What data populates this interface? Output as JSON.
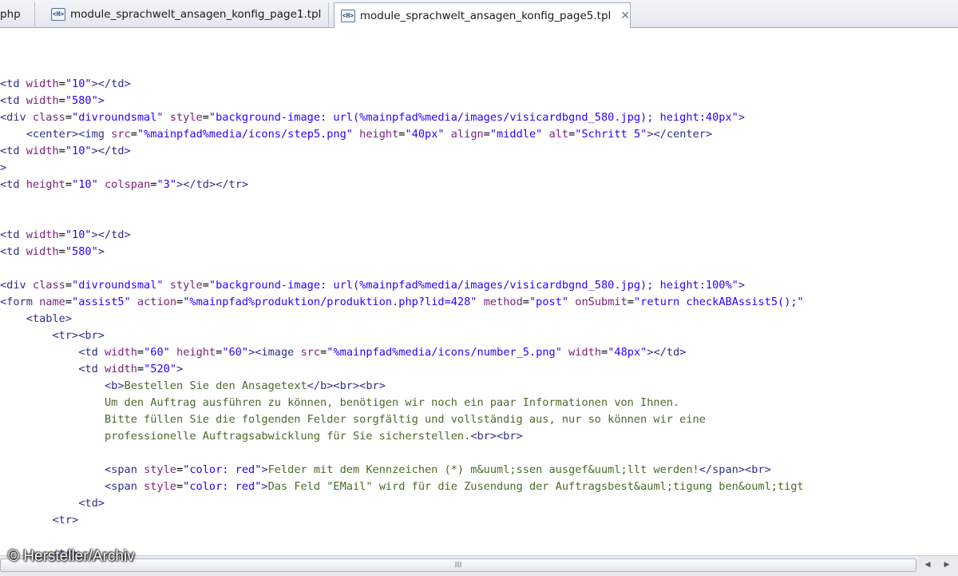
{
  "tabs": [
    {
      "label": "php",
      "active": false,
      "partial": true
    },
    {
      "label": "module_sprachwelt_ansagen_konfig_page1.tpl",
      "active": false,
      "icon": "html-file-icon"
    },
    {
      "label": "module_sprachwelt_ansagen_konfig_page5.tpl",
      "active": true,
      "icon": "html-file-icon",
      "close": "✕"
    }
  ],
  "code_lines": [
    [
      [
        "tag",
        "<td "
      ],
      [
        "attr",
        "width"
      ],
      [
        "plain",
        "="
      ],
      [
        "val",
        "\"10\""
      ],
      [
        "tag",
        "></td>"
      ]
    ],
    [
      [
        "tag",
        "<td "
      ],
      [
        "attr",
        "width"
      ],
      [
        "plain",
        "="
      ],
      [
        "val",
        "\"580\""
      ],
      [
        "tag",
        ">"
      ]
    ],
    [
      [
        "tag",
        "<div "
      ],
      [
        "attr",
        "class"
      ],
      [
        "plain",
        "="
      ],
      [
        "val",
        "\"divroundsmal\""
      ],
      [
        "plain",
        " "
      ],
      [
        "attr",
        "style"
      ],
      [
        "plain",
        "="
      ],
      [
        "val",
        "\"background-image: url(%mainpfad%media/images/visicardbgnd_580.jpg); height:40px\""
      ],
      [
        "tag",
        ">"
      ]
    ],
    [
      [
        "plain",
        "    "
      ],
      [
        "tag",
        "<center><img "
      ],
      [
        "attr",
        "src"
      ],
      [
        "plain",
        "="
      ],
      [
        "val",
        "\"%mainpfad%media/icons/step5.png\""
      ],
      [
        "plain",
        " "
      ],
      [
        "attr",
        "height"
      ],
      [
        "plain",
        "="
      ],
      [
        "val",
        "\"40px\""
      ],
      [
        "plain",
        " "
      ],
      [
        "attr",
        "align"
      ],
      [
        "plain",
        "="
      ],
      [
        "val",
        "\"middle\""
      ],
      [
        "plain",
        " "
      ],
      [
        "attr",
        "alt"
      ],
      [
        "plain",
        "="
      ],
      [
        "val",
        "\"Schritt 5\""
      ],
      [
        "tag",
        "></center>"
      ]
    ],
    [
      [
        "tag",
        "<td "
      ],
      [
        "attr",
        "width"
      ],
      [
        "plain",
        "="
      ],
      [
        "val",
        "\"10\""
      ],
      [
        "tag",
        "></td>"
      ]
    ],
    [
      [
        "tag",
        ">"
      ]
    ],
    [
      [
        "tag",
        "<td "
      ],
      [
        "attr",
        "height"
      ],
      [
        "plain",
        "="
      ],
      [
        "val",
        "\"10\""
      ],
      [
        "plain",
        " "
      ],
      [
        "attr",
        "colspan"
      ],
      [
        "plain",
        "="
      ],
      [
        "val",
        "\"3\""
      ],
      [
        "tag",
        "></td></tr>"
      ]
    ],
    [],
    [],
    [
      [
        "tag",
        "<td "
      ],
      [
        "attr",
        "width"
      ],
      [
        "plain",
        "="
      ],
      [
        "val",
        "\"10\""
      ],
      [
        "tag",
        "></td>"
      ]
    ],
    [
      [
        "tag",
        "<td "
      ],
      [
        "attr",
        "width"
      ],
      [
        "plain",
        "="
      ],
      [
        "val",
        "\"580\""
      ],
      [
        "tag",
        ">"
      ]
    ],
    [],
    [
      [
        "tag",
        "<div "
      ],
      [
        "attr",
        "class"
      ],
      [
        "plain",
        "="
      ],
      [
        "val",
        "\"divroundsmal\""
      ],
      [
        "plain",
        " "
      ],
      [
        "attr",
        "style"
      ],
      [
        "plain",
        "="
      ],
      [
        "val",
        "\"background-image: url(%mainpfad%media/images/visicardbgnd_580.jpg); height:100%\""
      ],
      [
        "tag",
        ">"
      ]
    ],
    [
      [
        "tag",
        "<form "
      ],
      [
        "attr",
        "name"
      ],
      [
        "plain",
        "="
      ],
      [
        "val",
        "\"assist5\""
      ],
      [
        "plain",
        " "
      ],
      [
        "attr",
        "action"
      ],
      [
        "plain",
        "="
      ],
      [
        "val",
        "\"%mainpfad%produktion/produktion.php?lid=428\""
      ],
      [
        "plain",
        " "
      ],
      [
        "attr",
        "method"
      ],
      [
        "plain",
        "="
      ],
      [
        "val",
        "\"post\""
      ],
      [
        "plain",
        " "
      ],
      [
        "attr",
        "onSubmit"
      ],
      [
        "plain",
        "="
      ],
      [
        "val",
        "\"return checkABAssist5();\""
      ]
    ],
    [
      [
        "plain",
        "    "
      ],
      [
        "tag",
        "<table>"
      ]
    ],
    [
      [
        "plain",
        "        "
      ],
      [
        "tag",
        "<tr><br>"
      ]
    ],
    [
      [
        "plain",
        "            "
      ],
      [
        "tag",
        "<td "
      ],
      [
        "attr",
        "width"
      ],
      [
        "plain",
        "="
      ],
      [
        "val",
        "\"60\""
      ],
      [
        "plain",
        " "
      ],
      [
        "attr",
        "height"
      ],
      [
        "plain",
        "="
      ],
      [
        "val",
        "\"60\""
      ],
      [
        "tag",
        "><image "
      ],
      [
        "attr",
        "src"
      ],
      [
        "plain",
        "="
      ],
      [
        "val",
        "\"%mainpfad%media/icons/number_5.png\""
      ],
      [
        "plain",
        " "
      ],
      [
        "attr",
        "width"
      ],
      [
        "plain",
        "="
      ],
      [
        "val",
        "\"48px\""
      ],
      [
        "tag",
        "></td>"
      ]
    ],
    [
      [
        "plain",
        "            "
      ],
      [
        "tag",
        "<td "
      ],
      [
        "attr",
        "width"
      ],
      [
        "plain",
        "="
      ],
      [
        "val",
        "\"520\""
      ],
      [
        "tag",
        ">"
      ]
    ],
    [
      [
        "plain",
        "                "
      ],
      [
        "tag",
        "<b>"
      ],
      [
        "text",
        "Bestellen Sie den Ansagetext"
      ],
      [
        "tag",
        "</b><br><br>"
      ]
    ],
    [
      [
        "plain",
        "                "
      ],
      [
        "text",
        "Um den Auftrag ausführen zu können, benötigen wir noch ein paar Informationen von Ihnen."
      ]
    ],
    [
      [
        "plain",
        "                "
      ],
      [
        "text",
        "Bitte füllen Sie die folgenden Felder sorgfältig und vollständig aus, nur so können wir eine"
      ]
    ],
    [
      [
        "plain",
        "                "
      ],
      [
        "text",
        "professionelle Auftragsabwicklung für Sie sicherstellen."
      ],
      [
        "tag",
        "<br><br>"
      ]
    ],
    [],
    [
      [
        "plain",
        "                "
      ],
      [
        "tag",
        "<span "
      ],
      [
        "attr",
        "style"
      ],
      [
        "plain",
        "="
      ],
      [
        "val",
        "\"color: red\""
      ],
      [
        "tag",
        ">"
      ],
      [
        "text",
        "Felder mit dem Kennzeichen (*) m&uuml;ssen ausgef&uuml;llt werden!"
      ],
      [
        "tag",
        "</span><br>"
      ]
    ],
    [
      [
        "plain",
        "                "
      ],
      [
        "tag",
        "<span "
      ],
      [
        "attr",
        "style"
      ],
      [
        "plain",
        "="
      ],
      [
        "val",
        "\"color: red\""
      ],
      [
        "tag",
        ">"
      ],
      [
        "text",
        "Das Feld \"EMail\" wird für die Zusendung der Auftragsbest&auml;tigung ben&ouml;tigt"
      ]
    ],
    [
      [
        "plain",
        "            "
      ],
      [
        "tag",
        "<td>"
      ]
    ],
    [
      [
        "plain",
        "        "
      ],
      [
        "tag",
        "<tr>"
      ]
    ],
    [],
    [
      [
        "plain",
        "        "
      ],
      [
        "tag",
        "<tr>"
      ]
    ]
  ],
  "scrollbar": {
    "thumb_grip": "III"
  },
  "watermark": "© Hersteller/Archiv"
}
